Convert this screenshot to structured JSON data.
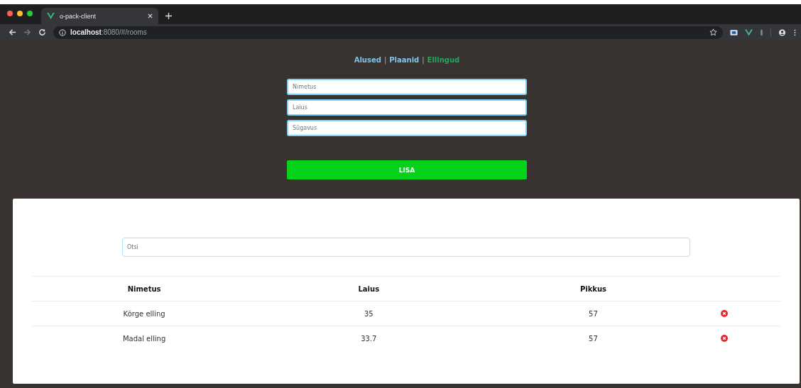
{
  "browser": {
    "tab_title": "o-pack-client",
    "url_host": "localhost",
    "url_rest": ":8080/#/rooms"
  },
  "nav": [
    {
      "label": "Alused",
      "selected": false
    },
    {
      "label": "Plaanid",
      "selected": false
    },
    {
      "label": "Ellingud",
      "selected": true
    }
  ],
  "nav_separator": "|",
  "form": {
    "fields": [
      {
        "placeholder": "Nimetus"
      },
      {
        "placeholder": "Laius"
      },
      {
        "placeholder": "Sügavus"
      }
    ],
    "submit": "LISA"
  },
  "search": {
    "placeholder": "Otsi"
  },
  "table": {
    "columns": [
      "Nimetus",
      "Laius",
      "Pikkus"
    ],
    "rows": [
      {
        "cells": [
          "Kõrge elling",
          "35",
          "57"
        ]
      },
      {
        "cells": [
          "Madal elling",
          "33.7",
          "57"
        ]
      }
    ]
  }
}
